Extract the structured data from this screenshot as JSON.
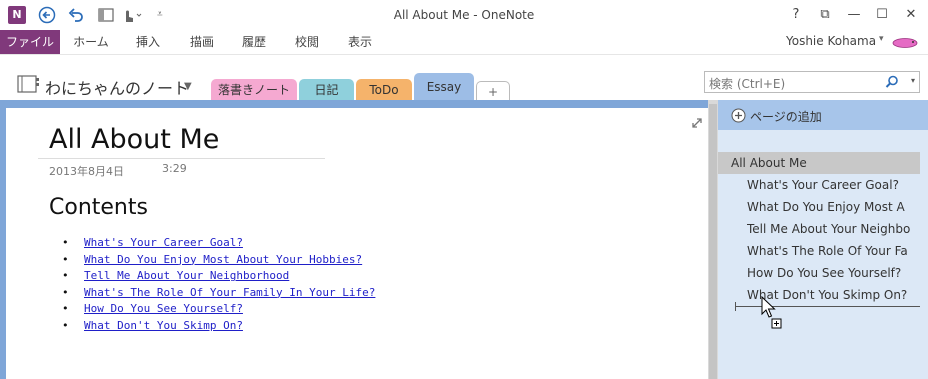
{
  "window": {
    "title": "All About Me - OneNote",
    "controls": {
      "help": "?",
      "restore": "⧉",
      "minimize": "—",
      "maximize": "☐",
      "close": "✕"
    }
  },
  "app_icon": "N",
  "ribbon": {
    "tabs": [
      "ファイル",
      "ホーム",
      "挿入",
      "描画",
      "履歴",
      "校閲",
      "表示"
    ],
    "user_name": "Yoshie Kohama",
    "user_caret": "▾"
  },
  "notebook": {
    "name": "わにちゃんのノート",
    "caret": "▼",
    "sections": [
      {
        "label": "落書きノート",
        "color": "#f5a9d1"
      },
      {
        "label": "日記",
        "color": "#8fd0dc"
      },
      {
        "label": "ToDo",
        "color": "#f5b36b"
      },
      {
        "label": "Essay",
        "color": "#9dbde6"
      },
      {
        "label": "+",
        "color": "#ffffff"
      }
    ]
  },
  "search": {
    "placeholder": "検索 (Ctrl+E)",
    "caret": "▾"
  },
  "page": {
    "title": "All About Me",
    "date": "2013年8月4日",
    "time": "3:29",
    "contents_heading": "Contents",
    "bullet": "•",
    "links": [
      "What's Your Career Goal?",
      "What Do You Enjoy Most About Your Hobbies?",
      "Tell Me About Your Neighborhood",
      "What's The Role Of Your Family In Your Life?",
      "How Do You See Yourself?",
      "What Don't You Skimp On?"
    ]
  },
  "pages_panel": {
    "add_page_label": "ページの追加",
    "selected": "All About Me",
    "subpages": [
      "What's Your Career Goal?",
      "What Do You Enjoy Most A",
      "Tell Me About Your Neighbo",
      "What's The Role Of Your Fa",
      "How Do You See Yourself?",
      "What Don't You Skimp On?"
    ]
  },
  "colors": {
    "onenote_purple": "#80397b",
    "page_panel_bg": "#dce8f6",
    "add_page_bar": "#a7c5ea",
    "selected_page": "#c8c8c8",
    "link_blue": "#1f1fc8"
  }
}
